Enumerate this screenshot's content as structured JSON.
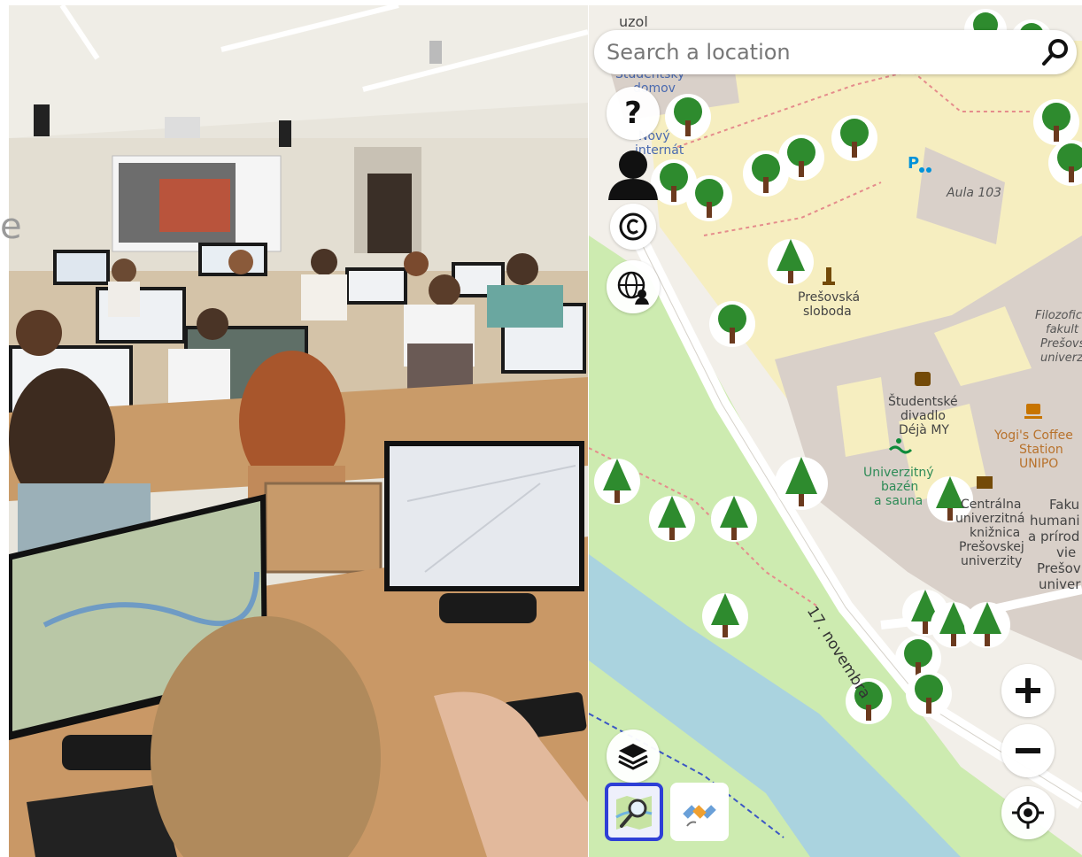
{
  "left_panel": {
    "side_text": "e"
  },
  "map": {
    "search": {
      "placeholder": "Search a location"
    },
    "controls": {
      "help": "?"
    },
    "labels": {
      "top_left_1": "uzol",
      "top_left_2": "Študentský",
      "top_left_3": "domov",
      "novy_1": "Nový",
      "novy_2": "internát",
      "aula": "Aula 103",
      "presovska_1": "Prešovská",
      "presovska_2": "sloboda",
      "filozof_1": "Filozofic",
      "filozof_2": "fakult",
      "filozof_3": "Prešovs",
      "filozof_4": "univerz",
      "divadlo_1": "Študentské",
      "divadlo_2": "divadlo",
      "divadlo_3": "Déjà MY",
      "coffee_1": "Yogi's Coffee",
      "coffee_2": "Station",
      "coffee_3": "UNIPO",
      "bazen_1": "Univerzitný",
      "bazen_2": "bazén",
      "bazen_3": "a sauna",
      "kniz_1": "Centrálna",
      "kniz_2": "univerzitná",
      "kniz_3": "knižnica",
      "kniz_4": "Prešovskej",
      "kniz_5": "univerzity",
      "faku_1": "Faku",
      "faku_2": "humani",
      "faku_3": "a prírod",
      "faku_4": "vie",
      "faku_5": "Prešov",
      "faku_6": "univer",
      "road": "17. novembra"
    },
    "colors": {
      "land": "#f2efe9",
      "campus": "#f6eec0",
      "building": "#d9d0c9",
      "park": "#cdebb0",
      "water": "#aad3df",
      "accent": "#2e3fd6"
    }
  }
}
